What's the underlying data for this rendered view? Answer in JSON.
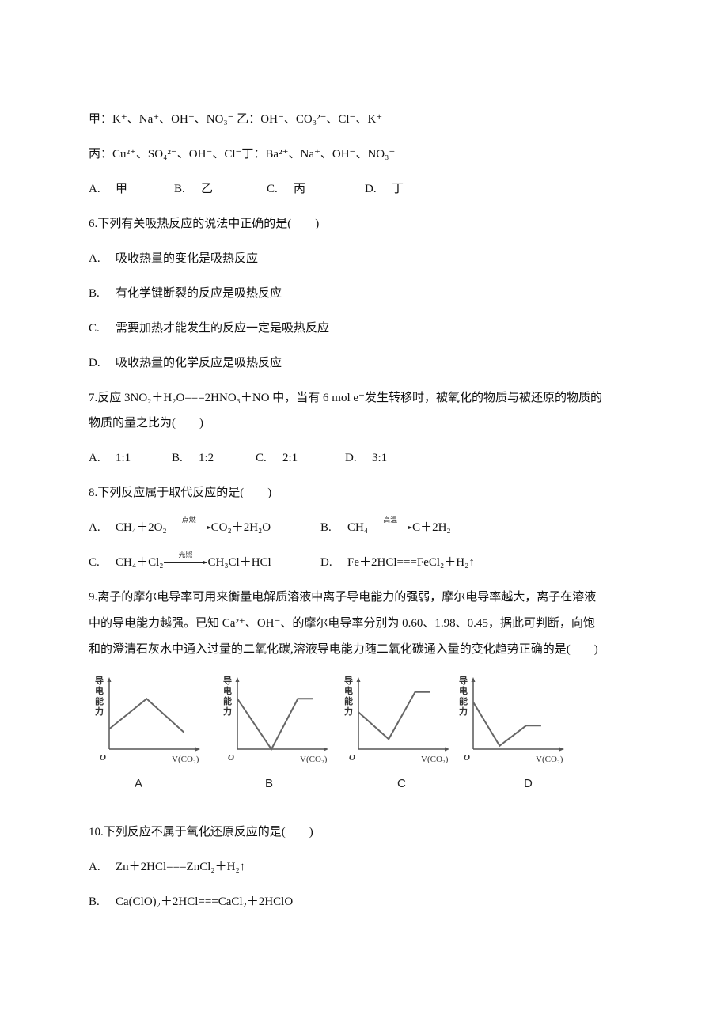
{
  "q5_ions": {
    "line1": "甲：K⁺、Na⁺、OH⁻、NO₃⁻ 乙：OH⁻、CO₃²⁻、Cl⁻、K⁺",
    "line2": "丙：Cu²⁺、SO₄²⁻、OH⁻、Cl⁻丁：Ba²⁺、Na⁺、OH⁻、NO₃⁻"
  },
  "q5_options": [
    {
      "label": "A.",
      "text": "甲"
    },
    {
      "label": "B.",
      "text": "乙"
    },
    {
      "label": "C.",
      "text": "丙"
    },
    {
      "label": "D.",
      "text": "丁"
    }
  ],
  "q6": {
    "stem": "6.下列有关吸热反应的说法中正确的是(　　)",
    "options": [
      {
        "label": "A.",
        "text": "吸收热量的变化是吸热反应"
      },
      {
        "label": "B.",
        "text": "有化学键断裂的反应是吸热反应"
      },
      {
        "label": "C.",
        "text": "需要加热才能发生的反应一定是吸热反应"
      },
      {
        "label": "D.",
        "text": "吸收热量的化学反应是吸热反应"
      }
    ]
  },
  "q7": {
    "stem_line1": "7.反应 3NO₂＋H₂O===2HNO₃＋NO 中，当有 6 mol e⁻发生转移时，被氧化的物质与被还原的物质的",
    "stem_line2": "物质的量之比为(　　)",
    "options": [
      {
        "label": "A.",
        "text": "1:1"
      },
      {
        "label": "B.",
        "text": "1:2"
      },
      {
        "label": "C.",
        "text": "2:1"
      },
      {
        "label": "D.",
        "text": "3:1"
      }
    ]
  },
  "q8": {
    "stem": "8.下列反应属于取代反应的是(　　)",
    "options": [
      {
        "label": "A.",
        "left": "CH₄＋2O₂",
        "condition": "点燃",
        "right": "CO₂＋2H₂O"
      },
      {
        "label": "B.",
        "left": "CH₄",
        "condition": "高温",
        "right": "C＋2H₂"
      },
      {
        "label": "C.",
        "left": "CH₄＋Cl₂",
        "condition": "光照",
        "right": "CH₃Cl＋HCl"
      },
      {
        "label": "D.",
        "text": "Fe＋2HCl===FeCl₂＋H₂↑"
      }
    ]
  },
  "q9": {
    "stem_line1": "9.离子的摩尔电导率可用来衡量电解质溶液中离子导电能力的强弱，摩尔电导率越大，离子在溶液",
    "stem_line2": "中的导电能力越强。已知 Ca²⁺、OH⁻、的摩尔电导率分别为 0.60、1.98、0.45，据此可判断，向饱",
    "stem_line3": "和的澄清石灰水中通入过量的二氧化碳,溶液导电能力随二氧化碳通入量的变化趋势正确的是(　　)",
    "graph_ylabel": [
      "导",
      "电",
      "能",
      "力"
    ],
    "graph_origin": "O",
    "graph_xlabel": "V(CO₂)"
  },
  "chart_data": [
    {
      "type": "line",
      "title": "A",
      "xlabel": "V(CO₂)",
      "ylabel": "导电能力",
      "x": [
        0,
        0.45,
        0.9
      ],
      "y": [
        0.3,
        0.75,
        0.25
      ],
      "xlim": [
        0,
        1
      ],
      "ylim": [
        0,
        1
      ]
    },
    {
      "type": "line",
      "title": "B",
      "xlabel": "V(CO₂)",
      "ylabel": "导电能力",
      "x": [
        0,
        0.45,
        0.8,
        1.0
      ],
      "y": [
        0.75,
        0.0,
        0.75,
        0.75
      ],
      "xlim": [
        0,
        1.1
      ],
      "ylim": [
        0,
        1
      ]
    },
    {
      "type": "line",
      "title": "C",
      "xlabel": "V(CO₂)",
      "ylabel": "导电能力",
      "x": [
        0,
        0.4,
        0.75,
        0.95
      ],
      "y": [
        0.55,
        0.15,
        0.85,
        0.85
      ],
      "xlim": [
        0,
        1.1
      ],
      "ylim": [
        0,
        1
      ]
    },
    {
      "type": "line",
      "title": "D",
      "xlabel": "V(CO₂)",
      "ylabel": "导电能力",
      "x": [
        0,
        0.35,
        0.7,
        0.9
      ],
      "y": [
        0.7,
        0.05,
        0.35,
        0.35
      ],
      "xlim": [
        0,
        1.1
      ],
      "ylim": [
        0,
        1
      ]
    }
  ],
  "q10": {
    "stem": "10.下列反应不属于氧化还原反应的是(　　)",
    "options": [
      {
        "label": "A.",
        "text": "Zn＋2HCl===ZnCl₂＋H₂↑"
      },
      {
        "label": "B.",
        "text": "Ca(ClO)₂＋2HCl===CaCl₂＋2HClO"
      }
    ]
  }
}
